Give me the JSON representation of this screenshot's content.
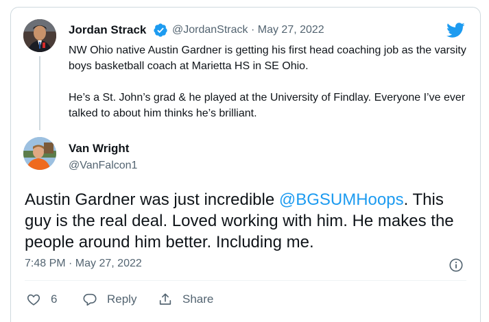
{
  "quoted_tweet": {
    "author_name": "Jordan Strack",
    "author_handle": "@JordanStrack",
    "separator": "·",
    "date": "May 27, 2022",
    "paragraphs": [
      "NW Ohio native Austin Gardner is getting his first head coaching job as the varsity boys basketball coach at Marietta HS in SE Ohio.",
      "He’s a St. John’s grad & he played at the University of Findlay. Everyone I’ve ever talked to about him thinks he’s brilliant."
    ]
  },
  "reply_tweet": {
    "author_name": "Van Wright",
    "author_handle": "@VanFalcon1",
    "text_before": "Austin Gardner was just incredible ",
    "mention": "@BGSUMHoops",
    "text_after": ". This guy is the real deal. Loved working with him. He makes the people around him better. Including me.",
    "timestamp": "7:48 PM · May 27, 2022"
  },
  "actions": {
    "like_count": "6",
    "reply_label": "Reply",
    "share_label": "Share"
  },
  "colors": {
    "accent": "#1d9bf0",
    "text": "#0f1419",
    "muted": "#536471",
    "border": "#cfd9de"
  },
  "icons": [
    "verified-badge-icon",
    "twitter-bird-icon",
    "info-icon",
    "heart-icon",
    "reply-icon",
    "share-icon"
  ]
}
